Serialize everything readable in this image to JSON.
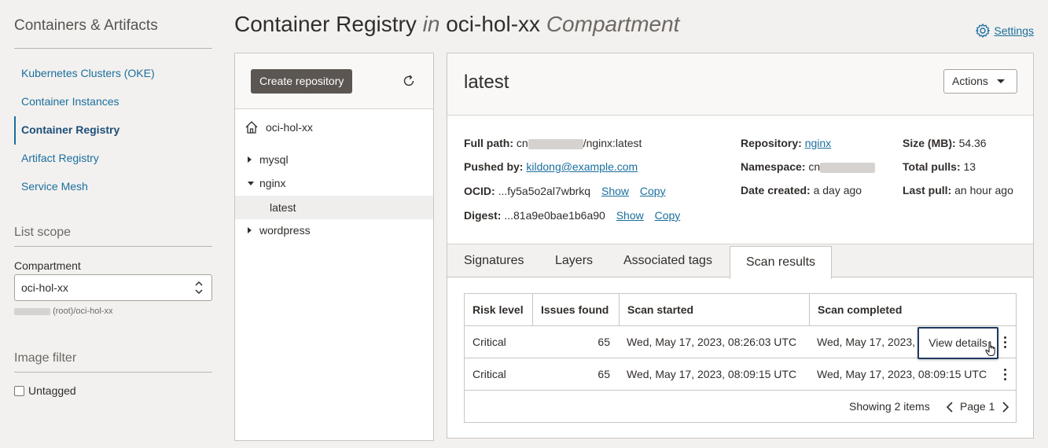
{
  "sidebar": {
    "title": "Containers & Artifacts",
    "nav": [
      {
        "label": "Kubernetes Clusters (OKE)"
      },
      {
        "label": "Container Instances"
      },
      {
        "label": "Container Registry",
        "active": true
      },
      {
        "label": "Artifact Registry"
      },
      {
        "label": "Service Mesh"
      }
    ],
    "list_scope_title": "List scope",
    "compartment_label": "Compartment",
    "compartment_value": "oci-hol-xx",
    "compartment_path": "(root)/oci-hol-xx",
    "image_filter_title": "Image filter",
    "untagged_label": "Untagged"
  },
  "header": {
    "title_main": "Container Registry",
    "title_in": "in",
    "title_compartment": "oci-hol-xx",
    "title_suffix": "Compartment",
    "settings_label": "Settings"
  },
  "tree": {
    "create_button": "Create repository",
    "root": "oci-hol-xx",
    "nodes": [
      {
        "label": "mysql",
        "expanded": false
      },
      {
        "label": "nginx",
        "expanded": true
      },
      {
        "label": "latest",
        "child": true,
        "selected": true
      },
      {
        "label": "wordpress",
        "expanded": false
      }
    ]
  },
  "detail": {
    "title": "latest",
    "actions_label": "Actions",
    "full_path_label": "Full path:",
    "full_path_prefix": "cn",
    "full_path_suffix": "/nginx:latest",
    "pushed_by_label": "Pushed by:",
    "pushed_by": "kildong@example.com",
    "ocid_label": "OCID:",
    "ocid_value": "...fy5a5o2al7wbrkq",
    "digest_label": "Digest:",
    "digest_value": "...81a9e0bae1b6a90",
    "show_label": "Show",
    "copy_label": "Copy",
    "repository_label": "Repository:",
    "repository": "nginx",
    "namespace_label": "Namespace:",
    "namespace_prefix": "cn",
    "date_created_label": "Date created:",
    "date_created": "a day ago",
    "size_label": "Size (MB):",
    "size": "54.36",
    "total_pulls_label": "Total pulls:",
    "total_pulls": "13",
    "last_pull_label": "Last pull:",
    "last_pull": "an hour ago"
  },
  "tabs": [
    "Signatures",
    "Layers",
    "Associated tags",
    "Scan results"
  ],
  "active_tab": "Scan results",
  "table": {
    "headers": [
      "Risk level",
      "Issues found",
      "Scan started",
      "Scan completed"
    ],
    "rows": [
      {
        "risk": "Critical",
        "issues": "65",
        "started": "Wed, May 17, 2023, 08:26:03 UTC",
        "completed": "Wed, May 17, 2023,"
      },
      {
        "risk": "Critical",
        "issues": "65",
        "started": "Wed, May 17, 2023, 08:09:15 UTC",
        "completed": "Wed, May 17, 2023, 08:09:15 UTC"
      }
    ],
    "view_details_label": "View details",
    "showing": "Showing 2 items",
    "page_label": "Page 1"
  }
}
